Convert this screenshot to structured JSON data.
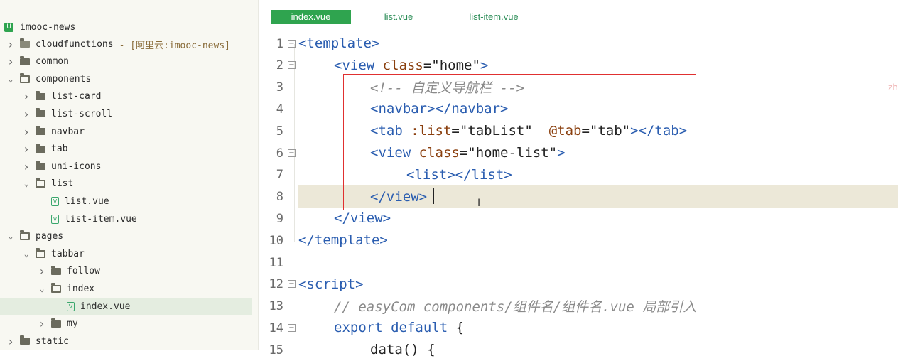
{
  "tabs": [
    {
      "label": "index.vue",
      "active": true
    },
    {
      "label": "list.vue",
      "active": false
    },
    {
      "label": "list-item.vue",
      "active": false
    }
  ],
  "project": {
    "name": "imooc-news",
    "icon": "uni-app-project-icon"
  },
  "tree": [
    {
      "label": "cloudfunctions",
      "tag": "- [阿里云:imooc-news]",
      "type": "cloud-folder",
      "chevron": "right"
    },
    {
      "label": "common",
      "type": "folder",
      "chevron": "right"
    },
    {
      "label": "components",
      "type": "folder-open",
      "chevron": "down"
    },
    {
      "label": "list-card",
      "type": "folder",
      "chevron": "right"
    },
    {
      "label": "list-scroll",
      "type": "folder",
      "chevron": "right"
    },
    {
      "label": "navbar",
      "type": "folder",
      "chevron": "right"
    },
    {
      "label": "tab",
      "type": "folder",
      "chevron": "right"
    },
    {
      "label": "uni-icons",
      "type": "folder",
      "chevron": "right"
    },
    {
      "label": "list",
      "type": "folder-open",
      "chevron": "down"
    },
    {
      "label": "list.vue",
      "type": "vue-file"
    },
    {
      "label": "list-item.vue",
      "type": "vue-file"
    },
    {
      "label": "pages",
      "type": "folder-open",
      "chevron": "down"
    },
    {
      "label": "tabbar",
      "type": "folder-open",
      "chevron": "down"
    },
    {
      "label": "follow",
      "type": "folder",
      "chevron": "right"
    },
    {
      "label": "index",
      "type": "folder-open",
      "chevron": "down"
    },
    {
      "label": "index.vue",
      "type": "vue-file",
      "selected": true
    },
    {
      "label": "my",
      "type": "folder",
      "chevron": "right"
    },
    {
      "label": "static",
      "type": "folder",
      "chevron": "right"
    }
  ],
  "code": [
    {
      "n": "1",
      "fold": true
    },
    {
      "n": "2",
      "fold": true
    },
    {
      "n": "3"
    },
    {
      "n": "4"
    },
    {
      "n": "5"
    },
    {
      "n": "6",
      "fold": true
    },
    {
      "n": "7"
    },
    {
      "n": "8"
    },
    {
      "n": "9"
    },
    {
      "n": "10"
    },
    {
      "n": "11"
    },
    {
      "n": "12",
      "fold": true
    },
    {
      "n": "13"
    },
    {
      "n": "14",
      "fold": true
    },
    {
      "n": "15"
    }
  ],
  "code_text": {
    "l1": "<template>",
    "l2_open": "<view ",
    "l2_attr": "class",
    "l2_val": "=\"home\"",
    "l2_close": ">",
    "l3": "<!-- 自定义导航栏 -->",
    "l4": "<navbar></navbar>",
    "l5_open": "<tab ",
    "l5_attr1": ":list",
    "l5_val1": "=\"tabList\"  ",
    "l5_attr2": "@tab",
    "l5_val2": "=\"tab\"",
    "l5_close": "></tab>",
    "l6_open": "<view ",
    "l6_attr": "class",
    "l6_val": "=\"home-list\"",
    "l6_close": ">",
    "l7": "<list></list>",
    "l8": "</view>",
    "l9": "</view>",
    "l10": "</template>",
    "l11": "",
    "l12": "<script>",
    "l13": "// easyCom components/组件名/组件名.vue 局部引入",
    "l14_kw": "export default",
    "l14_rest": " {",
    "l15": "data() {"
  },
  "margin_hint": "zh",
  "colors": {
    "accent": "#2fa44f",
    "highlight_box": "#e03030",
    "current_line": "#ece8d8"
  }
}
